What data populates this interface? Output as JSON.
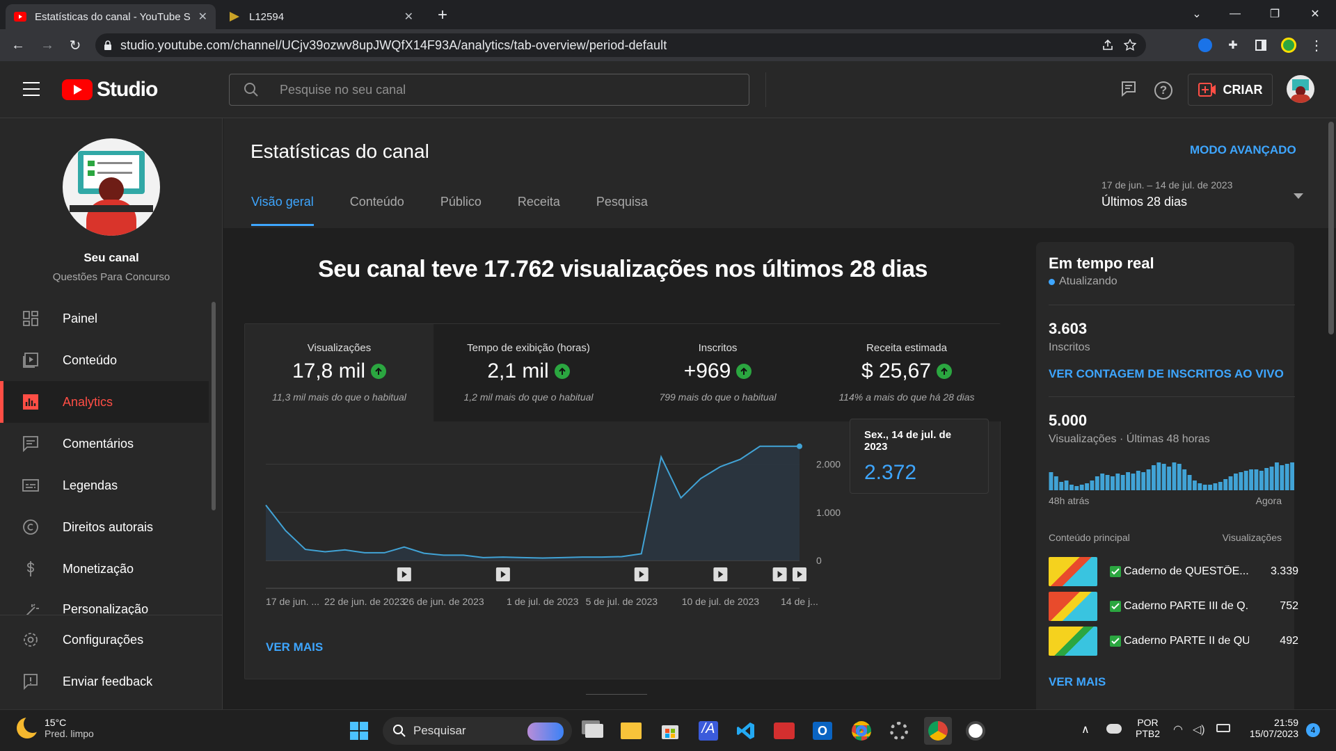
{
  "browser": {
    "tabs": [
      {
        "title": "Estatísticas do canal - YouTube S",
        "active": true
      },
      {
        "title": "L12594",
        "active": false
      }
    ],
    "url": "studio.youtube.com/channel/UCjv39ozwv8upJWQfX14F93A/analytics/tab-overview/period-default"
  },
  "header": {
    "logo_text": "Studio",
    "search_placeholder": "Pesquise no seu canal",
    "create_label": "CRIAR"
  },
  "sidebar": {
    "channel_label": "Seu canal",
    "channel_name": "Questões Para Concurso",
    "items": [
      {
        "label": "Painel",
        "icon": "dashboard-icon"
      },
      {
        "label": "Conteúdo",
        "icon": "content-icon"
      },
      {
        "label": "Analytics",
        "icon": "analytics-icon",
        "active": true
      },
      {
        "label": "Comentários",
        "icon": "comments-icon"
      },
      {
        "label": "Legendas",
        "icon": "subtitles-icon"
      },
      {
        "label": "Direitos autorais",
        "icon": "copyright-icon"
      },
      {
        "label": "Monetização",
        "icon": "dollar-icon"
      },
      {
        "label": "Personalização",
        "icon": "wand-icon"
      },
      {
        "label": "Configurações",
        "icon": "gear-icon"
      },
      {
        "label": "Enviar feedback",
        "icon": "feedback-icon"
      }
    ]
  },
  "page": {
    "title": "Estatísticas do canal",
    "advanced_mode": "MODO AVANÇADO",
    "tabs": [
      "Visão geral",
      "Conteúdo",
      "Público",
      "Receita",
      "Pesquisa"
    ],
    "date_range": "17 de jun. – 14 de jul. de 2023",
    "period": "Últimos 28 dias",
    "headline": "Seu canal teve 17.762 visualizações nos últimos 28 dias",
    "see_more": "VER MAIS"
  },
  "metrics": [
    {
      "title": "Visualizações",
      "value": "17,8 mil",
      "sub": "11,3 mil mais do que o habitual"
    },
    {
      "title": "Tempo de exibição (horas)",
      "value": "2,1 mil",
      "sub": "1,2 mil mais do que o habitual"
    },
    {
      "title": "Inscritos",
      "value": "+969",
      "sub": "799 mais do que o habitual"
    },
    {
      "title": "Receita estimada",
      "value": "$ 25,67",
      "sub": "114% a mais do que há 28 dias"
    }
  ],
  "tooltip": {
    "date": "Sex., 14 de jul. de 2023",
    "value": "2.372"
  },
  "chart_data": {
    "type": "area",
    "x": [
      "17 de jun.",
      "18 de jun.",
      "19 de jun.",
      "20 de jun.",
      "21 de jun.",
      "22 de jun.",
      "23 de jun.",
      "24 de jun.",
      "25 de jun.",
      "26 de jun.",
      "27 de jun.",
      "28 de jun.",
      "29 de jun.",
      "30 de jun.",
      "1 de jul.",
      "2 de jul.",
      "3 de jul.",
      "4 de jul.",
      "5 de jul.",
      "6 de jul.",
      "7 de jul.",
      "8 de jul.",
      "9 de jul.",
      "10 de jul.",
      "11 de jul.",
      "12 de jul.",
      "13 de jul.",
      "14 de jul."
    ],
    "series": [
      {
        "values": [
          1150,
          620,
          230,
          180,
          220,
          160,
          160,
          280,
          150,
          110,
          110,
          60,
          70,
          60,
          50,
          60,
          70,
          70,
          80,
          140,
          2150,
          1300,
          1700,
          1950,
          2100,
          2372,
          2372,
          2372
        ]
      }
    ],
    "tick_labels": [
      "17 de jun. ...",
      "22 de jun. de 2023",
      "26 de jun. de 2023",
      "1 de jul. de 2023",
      "5 de jul. de 2023",
      "10 de jul. de 2023",
      "14 de j..."
    ],
    "y_ticks": [
      "2.000",
      "1.000",
      "0"
    ],
    "ylim": [
      0,
      2600
    ],
    "grid": true
  },
  "realtime": {
    "title": "Em tempo real",
    "status": "Atualizando",
    "subs_value": "3.603",
    "subs_label": "Inscritos",
    "live_link": "VER CONTAGEM DE INSCRITOS AO VIVO",
    "views_value": "5.000",
    "views_label": "Visualizações · Últimas 48 horas",
    "bar_left": "48h atrás",
    "bar_right": "Agora",
    "bars": [
      26,
      20,
      12,
      14,
      8,
      6,
      8,
      10,
      14,
      20,
      24,
      22,
      20,
      24,
      22,
      26,
      24,
      28,
      26,
      30,
      36,
      40,
      38,
      34,
      40,
      38,
      30,
      22,
      14,
      10,
      8,
      8,
      10,
      12,
      16,
      20,
      24,
      26,
      28,
      30,
      30,
      28,
      32,
      34,
      40,
      36,
      38,
      40
    ],
    "top_content_label": "Conteúdo principal",
    "top_content_metric": "Visualizações",
    "videos": [
      {
        "title": "Caderno de QUESTÕE...",
        "views": "3.339"
      },
      {
        "title": "Caderno PARTE III de Q...",
        "views": "752"
      },
      {
        "title": "Caderno PARTE II de QU...",
        "views": "492"
      }
    ],
    "see_more": "VER MAIS"
  },
  "taskbar": {
    "weather_temp": "15°C",
    "weather_desc": "Pred. limpo",
    "search_label": "Pesquisar",
    "lang1": "POR",
    "lang2": "PTB2",
    "time": "21:59",
    "date": "15/07/2023",
    "notif_count": "4"
  },
  "colors": {
    "accent": "#3ea6ff",
    "brand": "#ff0000",
    "active": "#ff4e45",
    "up": "#2ba640"
  }
}
